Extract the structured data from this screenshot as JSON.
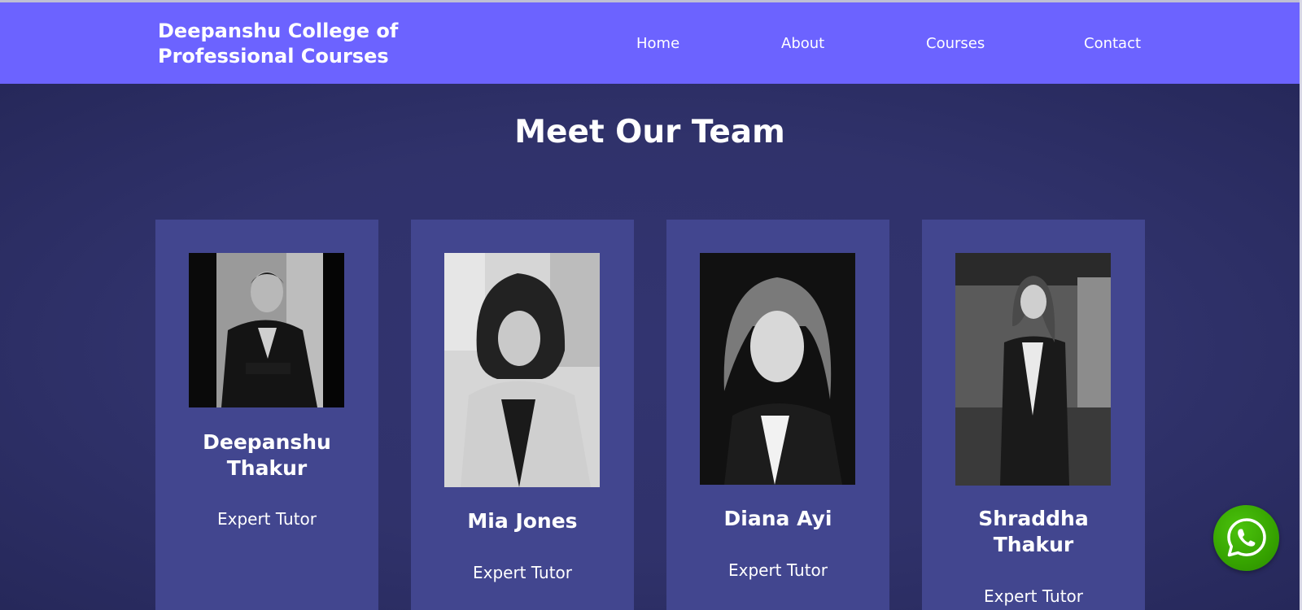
{
  "header": {
    "brand_line1": "Deepanshu College of",
    "brand_line2": "Professional Courses",
    "nav": [
      "Home",
      "About",
      "Courses",
      "Contact"
    ]
  },
  "team": {
    "title": "Meet Our Team",
    "members": [
      {
        "name_line1": "Deepanshu",
        "name_line2": "Thakur",
        "role": "Expert Tutor"
      },
      {
        "name_line1": "Mia Jones",
        "name_line2": "",
        "role": "Expert Tutor"
      },
      {
        "name_line1": "Diana Ayi",
        "name_line2": "",
        "role": "Expert Tutor"
      },
      {
        "name_line1": "Shraddha",
        "name_line2": "Thakur",
        "role": "Expert Tutor"
      }
    ]
  },
  "icons": {
    "whatsapp": "whatsapp-icon"
  },
  "colors": {
    "header_bg": "#6c63ff",
    "page_bg": "#2f3168",
    "card_bg": "#42468f",
    "whatsapp_green": "#36a300"
  }
}
